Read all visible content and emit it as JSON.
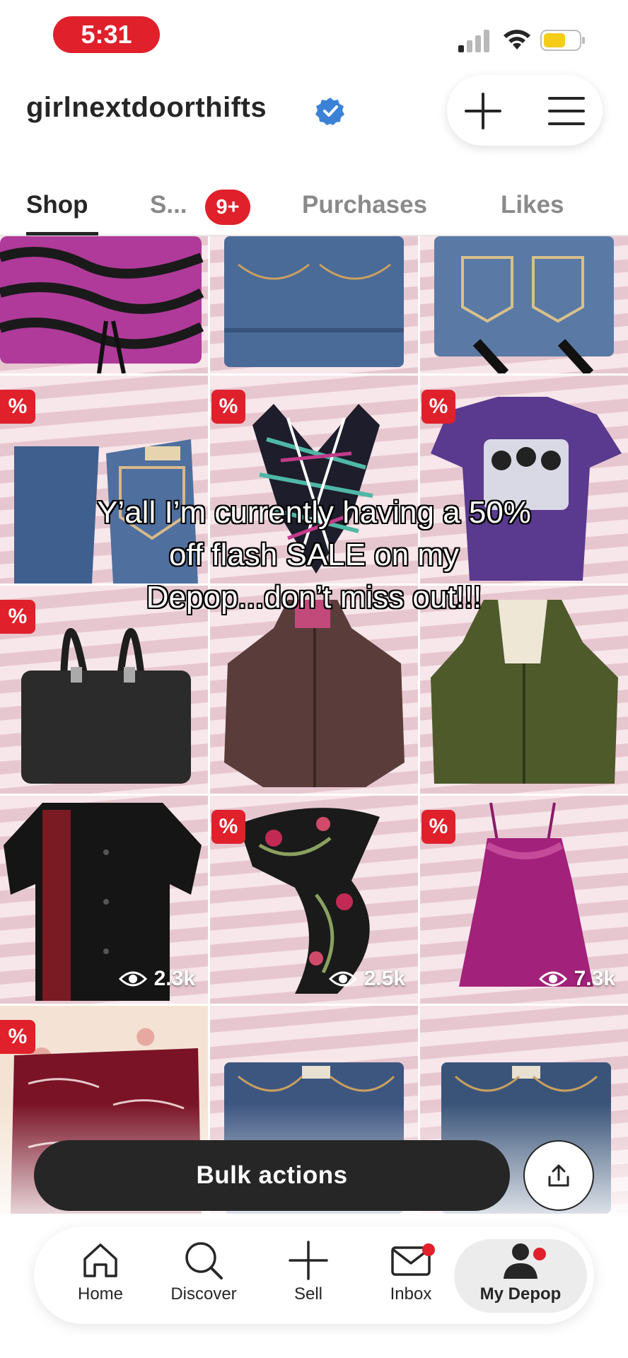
{
  "status": {
    "time": "5:31"
  },
  "header": {
    "username": "girlnextdoorthifts"
  },
  "tabs": [
    {
      "label": "Shop"
    },
    {
      "label": "S..."
    },
    {
      "label": "Purchases"
    },
    {
      "label": "Likes"
    }
  ],
  "tab_badge": "9+",
  "grid": {
    "discount_symbol": "%",
    "views": [
      "2.3k",
      "2.5k",
      "7.3k"
    ]
  },
  "caption": "Y’all I’m currently having a 50% off flash SALE on my Depop...don’t miss out!!!",
  "bulk_actions_label": "Bulk actions",
  "nav": {
    "home": "Home",
    "discover": "Discover",
    "sell": "Sell",
    "inbox": "Inbox",
    "my_depop": "My Depop"
  },
  "colors": {
    "accent": "#e0202b",
    "dark": "#262626"
  }
}
